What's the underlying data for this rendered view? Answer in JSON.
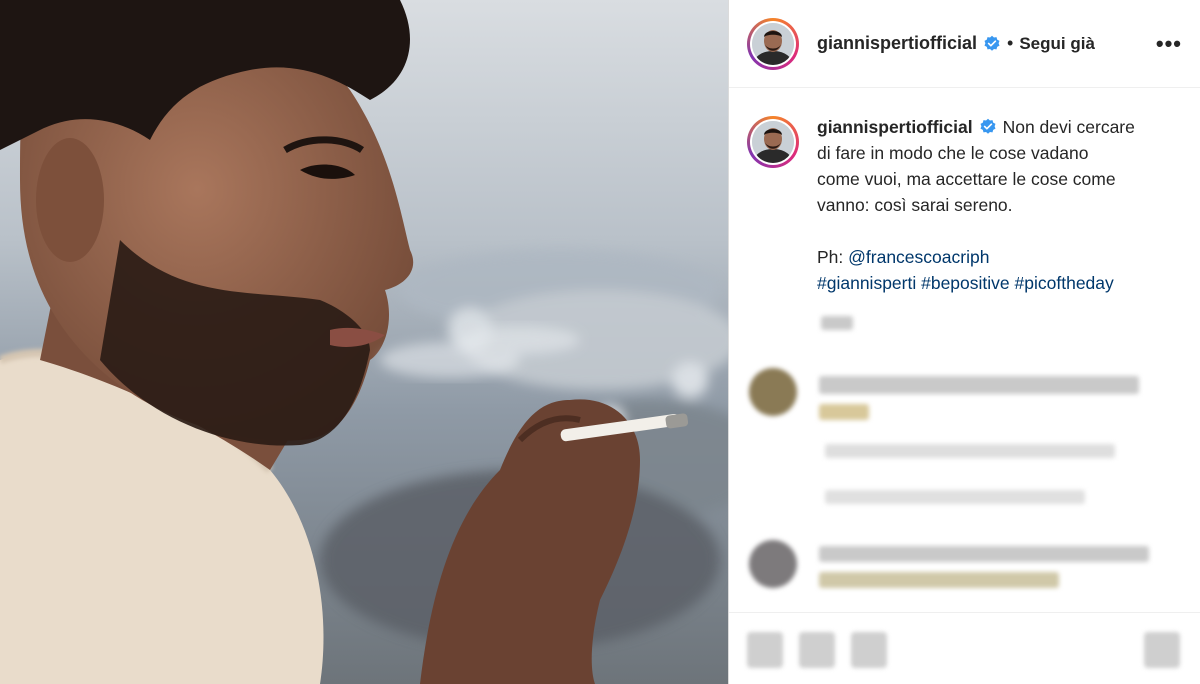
{
  "post": {
    "username": "giannispertiofficial",
    "follow_status": "Segui già",
    "more_label": "•••",
    "separator": "•",
    "caption": {
      "line1": "Non devi cercare",
      "line2": "di fare in modo che le cose vadano",
      "line3": "come vuoi, ma accettare le cose come",
      "line4": "vanno: così sarai sereno.",
      "credit_prefix": "Ph: ",
      "credit_handle": "@francescoacriph",
      "hashtags": [
        "#giannisperti",
        "#bepositive",
        "#picoftheday"
      ]
    }
  },
  "icons": {
    "verified": "verified-badge-icon",
    "more": "more-options-icon"
  },
  "colors": {
    "link": "#00376b",
    "verified": "#3897f0",
    "text": "#262626"
  }
}
